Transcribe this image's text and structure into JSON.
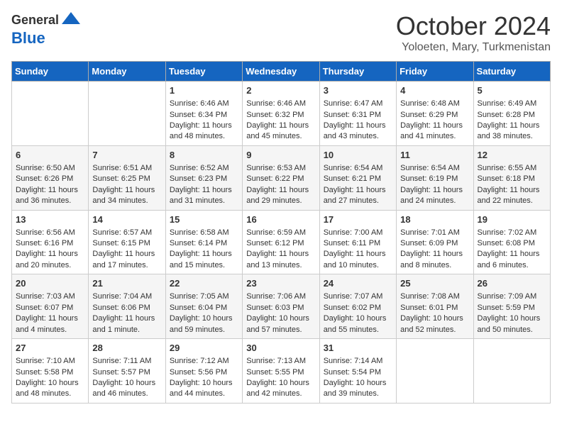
{
  "header": {
    "logo_line1": "General",
    "logo_line2": "Blue",
    "month": "October 2024",
    "location": "Yoloeten, Mary, Turkmenistan"
  },
  "weekdays": [
    "Sunday",
    "Monday",
    "Tuesday",
    "Wednesday",
    "Thursday",
    "Friday",
    "Saturday"
  ],
  "weeks": [
    [
      {
        "day": "",
        "sunrise": "",
        "sunset": "",
        "daylight": ""
      },
      {
        "day": "",
        "sunrise": "",
        "sunset": "",
        "daylight": ""
      },
      {
        "day": "1",
        "sunrise": "Sunrise: 6:46 AM",
        "sunset": "Sunset: 6:34 PM",
        "daylight": "Daylight: 11 hours and 48 minutes."
      },
      {
        "day": "2",
        "sunrise": "Sunrise: 6:46 AM",
        "sunset": "Sunset: 6:32 PM",
        "daylight": "Daylight: 11 hours and 45 minutes."
      },
      {
        "day": "3",
        "sunrise": "Sunrise: 6:47 AM",
        "sunset": "Sunset: 6:31 PM",
        "daylight": "Daylight: 11 hours and 43 minutes."
      },
      {
        "day": "4",
        "sunrise": "Sunrise: 6:48 AM",
        "sunset": "Sunset: 6:29 PM",
        "daylight": "Daylight: 11 hours and 41 minutes."
      },
      {
        "day": "5",
        "sunrise": "Sunrise: 6:49 AM",
        "sunset": "Sunset: 6:28 PM",
        "daylight": "Daylight: 11 hours and 38 minutes."
      }
    ],
    [
      {
        "day": "6",
        "sunrise": "Sunrise: 6:50 AM",
        "sunset": "Sunset: 6:26 PM",
        "daylight": "Daylight: 11 hours and 36 minutes."
      },
      {
        "day": "7",
        "sunrise": "Sunrise: 6:51 AM",
        "sunset": "Sunset: 6:25 PM",
        "daylight": "Daylight: 11 hours and 34 minutes."
      },
      {
        "day": "8",
        "sunrise": "Sunrise: 6:52 AM",
        "sunset": "Sunset: 6:23 PM",
        "daylight": "Daylight: 11 hours and 31 minutes."
      },
      {
        "day": "9",
        "sunrise": "Sunrise: 6:53 AM",
        "sunset": "Sunset: 6:22 PM",
        "daylight": "Daylight: 11 hours and 29 minutes."
      },
      {
        "day": "10",
        "sunrise": "Sunrise: 6:54 AM",
        "sunset": "Sunset: 6:21 PM",
        "daylight": "Daylight: 11 hours and 27 minutes."
      },
      {
        "day": "11",
        "sunrise": "Sunrise: 6:54 AM",
        "sunset": "Sunset: 6:19 PM",
        "daylight": "Daylight: 11 hours and 24 minutes."
      },
      {
        "day": "12",
        "sunrise": "Sunrise: 6:55 AM",
        "sunset": "Sunset: 6:18 PM",
        "daylight": "Daylight: 11 hours and 22 minutes."
      }
    ],
    [
      {
        "day": "13",
        "sunrise": "Sunrise: 6:56 AM",
        "sunset": "Sunset: 6:16 PM",
        "daylight": "Daylight: 11 hours and 20 minutes."
      },
      {
        "day": "14",
        "sunrise": "Sunrise: 6:57 AM",
        "sunset": "Sunset: 6:15 PM",
        "daylight": "Daylight: 11 hours and 17 minutes."
      },
      {
        "day": "15",
        "sunrise": "Sunrise: 6:58 AM",
        "sunset": "Sunset: 6:14 PM",
        "daylight": "Daylight: 11 hours and 15 minutes."
      },
      {
        "day": "16",
        "sunrise": "Sunrise: 6:59 AM",
        "sunset": "Sunset: 6:12 PM",
        "daylight": "Daylight: 11 hours and 13 minutes."
      },
      {
        "day": "17",
        "sunrise": "Sunrise: 7:00 AM",
        "sunset": "Sunset: 6:11 PM",
        "daylight": "Daylight: 11 hours and 10 minutes."
      },
      {
        "day": "18",
        "sunrise": "Sunrise: 7:01 AM",
        "sunset": "Sunset: 6:09 PM",
        "daylight": "Daylight: 11 hours and 8 minutes."
      },
      {
        "day": "19",
        "sunrise": "Sunrise: 7:02 AM",
        "sunset": "Sunset: 6:08 PM",
        "daylight": "Daylight: 11 hours and 6 minutes."
      }
    ],
    [
      {
        "day": "20",
        "sunrise": "Sunrise: 7:03 AM",
        "sunset": "Sunset: 6:07 PM",
        "daylight": "Daylight: 11 hours and 4 minutes."
      },
      {
        "day": "21",
        "sunrise": "Sunrise: 7:04 AM",
        "sunset": "Sunset: 6:06 PM",
        "daylight": "Daylight: 11 hours and 1 minute."
      },
      {
        "day": "22",
        "sunrise": "Sunrise: 7:05 AM",
        "sunset": "Sunset: 6:04 PM",
        "daylight": "Daylight: 10 hours and 59 minutes."
      },
      {
        "day": "23",
        "sunrise": "Sunrise: 7:06 AM",
        "sunset": "Sunset: 6:03 PM",
        "daylight": "Daylight: 10 hours and 57 minutes."
      },
      {
        "day": "24",
        "sunrise": "Sunrise: 7:07 AM",
        "sunset": "Sunset: 6:02 PM",
        "daylight": "Daylight: 10 hours and 55 minutes."
      },
      {
        "day": "25",
        "sunrise": "Sunrise: 7:08 AM",
        "sunset": "Sunset: 6:01 PM",
        "daylight": "Daylight: 10 hours and 52 minutes."
      },
      {
        "day": "26",
        "sunrise": "Sunrise: 7:09 AM",
        "sunset": "Sunset: 5:59 PM",
        "daylight": "Daylight: 10 hours and 50 minutes."
      }
    ],
    [
      {
        "day": "27",
        "sunrise": "Sunrise: 7:10 AM",
        "sunset": "Sunset: 5:58 PM",
        "daylight": "Daylight: 10 hours and 48 minutes."
      },
      {
        "day": "28",
        "sunrise": "Sunrise: 7:11 AM",
        "sunset": "Sunset: 5:57 PM",
        "daylight": "Daylight: 10 hours and 46 minutes."
      },
      {
        "day": "29",
        "sunrise": "Sunrise: 7:12 AM",
        "sunset": "Sunset: 5:56 PM",
        "daylight": "Daylight: 10 hours and 44 minutes."
      },
      {
        "day": "30",
        "sunrise": "Sunrise: 7:13 AM",
        "sunset": "Sunset: 5:55 PM",
        "daylight": "Daylight: 10 hours and 42 minutes."
      },
      {
        "day": "31",
        "sunrise": "Sunrise: 7:14 AM",
        "sunset": "Sunset: 5:54 PM",
        "daylight": "Daylight: 10 hours and 39 minutes."
      },
      {
        "day": "",
        "sunrise": "",
        "sunset": "",
        "daylight": ""
      },
      {
        "day": "",
        "sunrise": "",
        "sunset": "",
        "daylight": ""
      }
    ]
  ]
}
